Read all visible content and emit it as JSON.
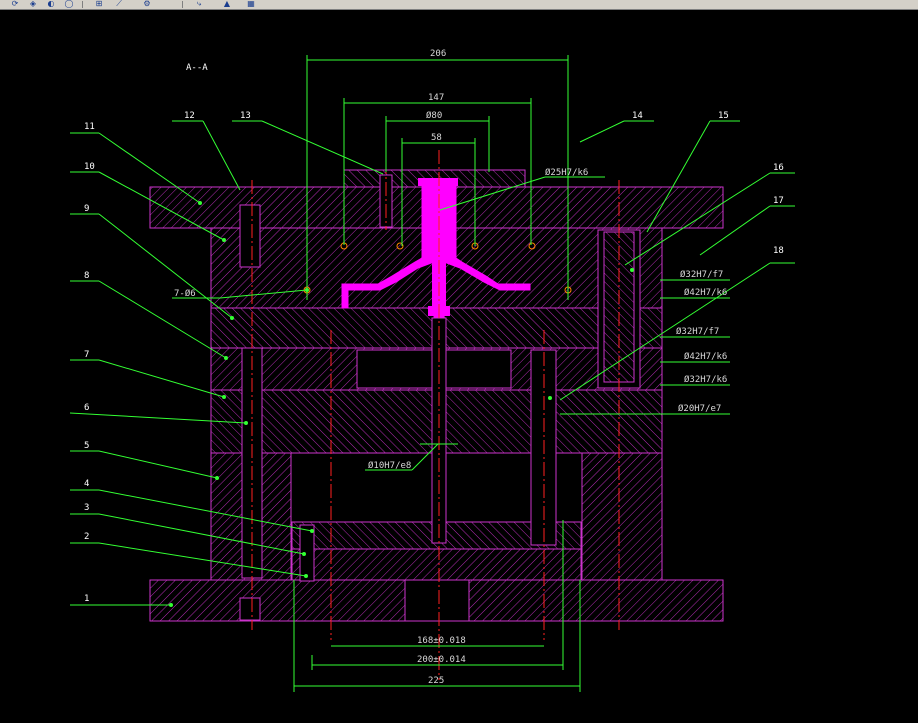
{
  "toolbar": {
    "icons": [
      "refresh-icon",
      "snap-icon",
      "orbit-icon",
      "zoom-icon",
      "pan-icon",
      "measure-icon",
      "properties-icon",
      "match-icon",
      "layer-icon"
    ]
  },
  "drawing": {
    "section_title": "A--A",
    "dims": {
      "d206": "206",
      "d147": "147",
      "d80": "Ø80",
      "d58": "58",
      "d25": "Ø25H7/k6",
      "d32f7a": "Ø32H7/f7",
      "d42k6a": "Ø42H7/k6",
      "d32f7b": "Ø32H7/f7",
      "d42k6b": "Ø42H7/k6",
      "d32k6": "Ø32H7/k6",
      "d20e7": "Ø20H7/e7",
      "d10e8": "Ø10H7/e8",
      "d7x6": "7-Ø6",
      "d168": "168±0.018",
      "d200": "200±0.014",
      "d225": "225"
    },
    "part_numbers": [
      "1",
      "2",
      "3",
      "4",
      "5",
      "6",
      "7",
      "8",
      "9",
      "10",
      "11",
      "12",
      "13",
      "14",
      "15",
      "16",
      "17",
      "18"
    ],
    "colors": {
      "plate": "#cc33cc",
      "hatch": "#cc33cc",
      "dim": "#33ff33",
      "center": "#ff2020",
      "leader": "#33ff33",
      "part": "#ff00ff",
      "text": "#ffffff"
    }
  }
}
